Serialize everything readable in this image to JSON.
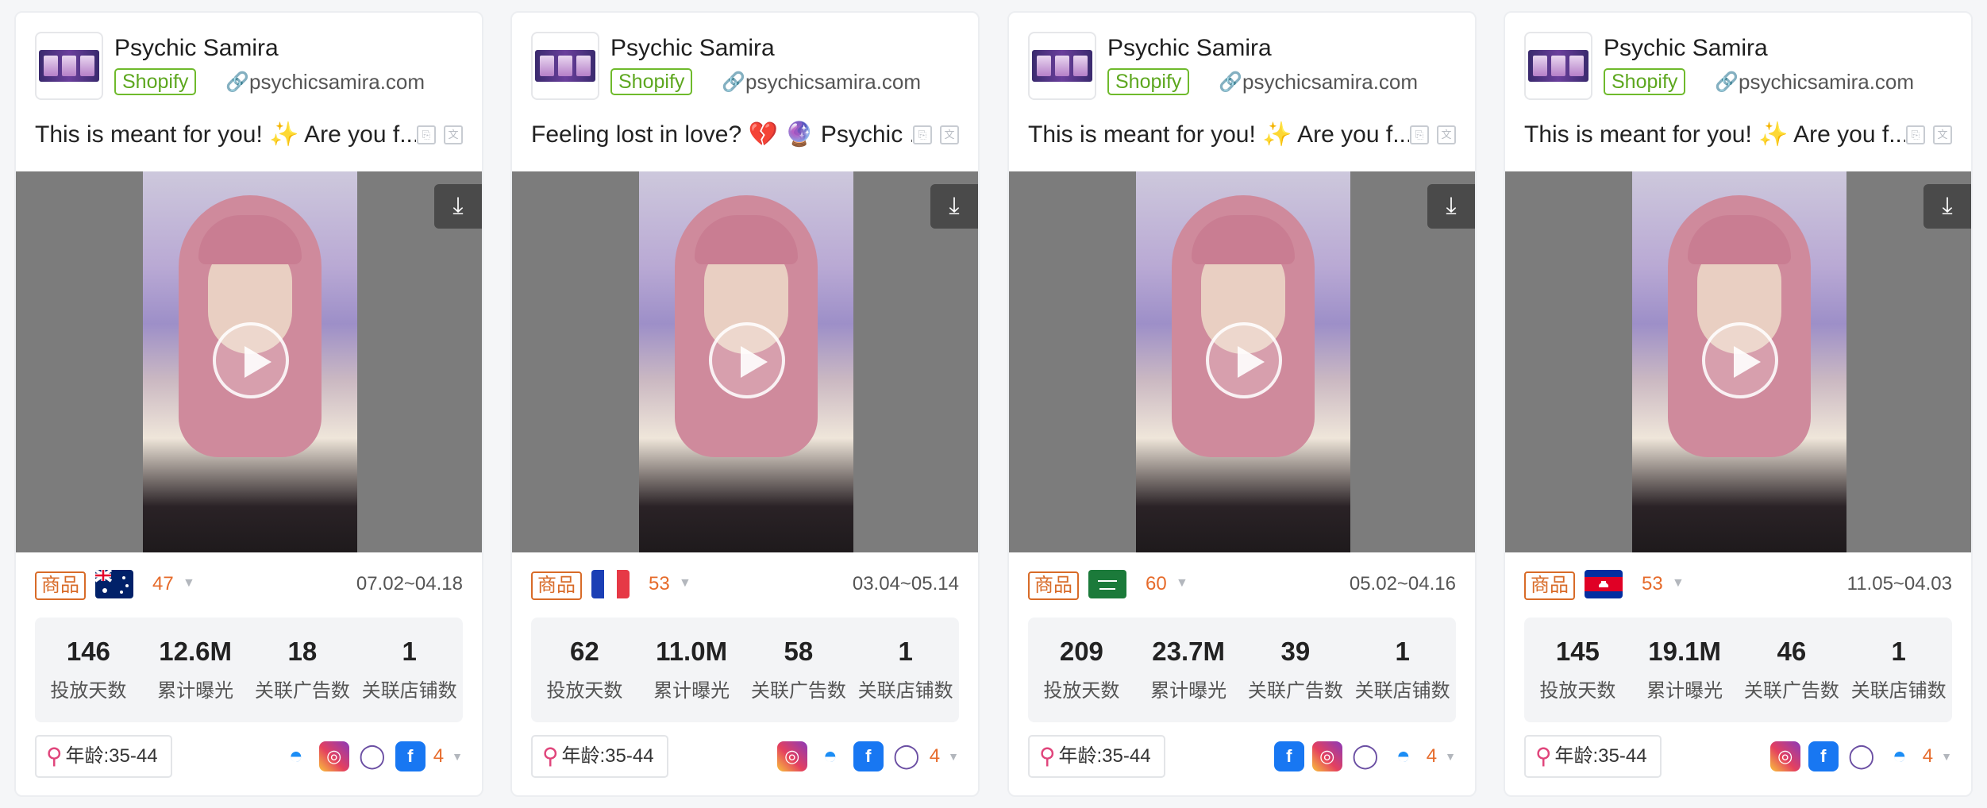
{
  "cards": [
    {
      "advertiser": "Psychic Samira",
      "platform": "Shopify",
      "domain": "psychicsamira.com",
      "ad_text": "This is meant for you! ✨ Are you f...",
      "tag": "商品",
      "country_flag": "australia",
      "count": "47",
      "dates": "07.02~04.18",
      "stats": [
        {
          "value": "146",
          "label": "投放天数"
        },
        {
          "value": "12.6M",
          "label": "累计曝光"
        },
        {
          "value": "18",
          "label": "关联广告数"
        },
        {
          "value": "1",
          "label": "关联店铺数"
        }
      ],
      "age": "年龄:35-44",
      "socials": [
        "messenger-icon",
        "instagram-icon",
        "audience-network-icon",
        "facebook-icon"
      ],
      "more": "4"
    },
    {
      "advertiser": "Psychic Samira",
      "platform": "Shopify",
      "domain": "psychicsamira.com",
      "ad_text": "Feeling lost in love? 💔 🔮 Psychic ...",
      "tag": "商品",
      "country_flag": "france",
      "count": "53",
      "dates": "03.04~05.14",
      "stats": [
        {
          "value": "62",
          "label": "投放天数"
        },
        {
          "value": "11.0M",
          "label": "累计曝光"
        },
        {
          "value": "58",
          "label": "关联广告数"
        },
        {
          "value": "1",
          "label": "关联店铺数"
        }
      ],
      "age": "年龄:35-44",
      "socials": [
        "instagram-icon",
        "messenger-icon",
        "facebook-icon",
        "audience-network-icon"
      ],
      "more": "4"
    },
    {
      "advertiser": "Psychic Samira",
      "platform": "Shopify",
      "domain": "psychicsamira.com",
      "ad_text": "This is meant for you! ✨ Are you f...",
      "tag": "商品",
      "country_flag": "saudi-arabia",
      "count": "60",
      "dates": "05.02~04.16",
      "stats": [
        {
          "value": "209",
          "label": "投放天数"
        },
        {
          "value": "23.7M",
          "label": "累计曝光"
        },
        {
          "value": "39",
          "label": "关联广告数"
        },
        {
          "value": "1",
          "label": "关联店铺数"
        }
      ],
      "age": "年龄:35-44",
      "socials": [
        "facebook-icon",
        "instagram-icon",
        "audience-network-icon",
        "messenger-icon"
      ],
      "more": "4"
    },
    {
      "advertiser": "Psychic Samira",
      "platform": "Shopify",
      "domain": "psychicsamira.com",
      "ad_text": "This is meant for you! ✨ Are you f...",
      "tag": "商品",
      "country_flag": "cambodia",
      "count": "53",
      "dates": "11.05~04.03",
      "stats": [
        {
          "value": "145",
          "label": "投放天数"
        },
        {
          "value": "19.1M",
          "label": "累计曝光"
        },
        {
          "value": "46",
          "label": "关联广告数"
        },
        {
          "value": "1",
          "label": "关联店铺数"
        }
      ],
      "age": "年龄:35-44",
      "socials": [
        "instagram-icon",
        "facebook-icon",
        "audience-network-icon",
        "messenger-icon"
      ],
      "more": "4"
    }
  ]
}
